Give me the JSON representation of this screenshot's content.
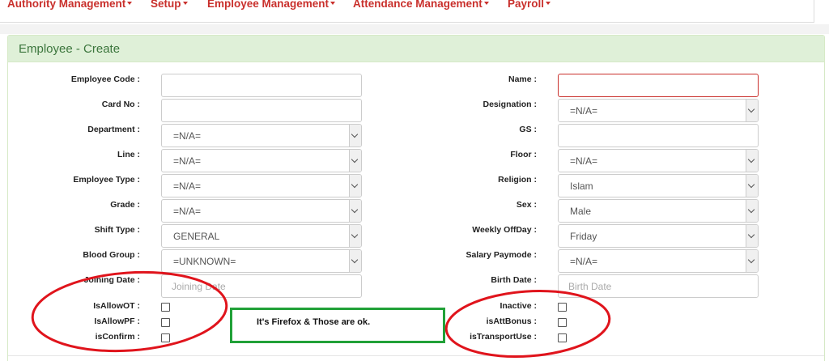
{
  "nav": {
    "items": [
      {
        "label": "Authority Management"
      },
      {
        "label": "Setup"
      },
      {
        "label": "Employee Management"
      },
      {
        "label": "Attendance Management"
      },
      {
        "label": "Payroll"
      }
    ]
  },
  "panel": {
    "title": "Employee - Create"
  },
  "form": {
    "employee_code": {
      "label": "Employee Code :",
      "value": ""
    },
    "card_no": {
      "label": "Card No :",
      "value": ""
    },
    "department": {
      "label": "Department :",
      "value": "=N/A="
    },
    "line": {
      "label": "Line :",
      "value": "=N/A="
    },
    "employee_type": {
      "label": "Employee Type :",
      "value": "=N/A="
    },
    "grade": {
      "label": "Grade :",
      "value": "=N/A="
    },
    "shift_type": {
      "label": "Shift Type :",
      "value": "GENERAL"
    },
    "blood_group": {
      "label": "Blood Group :",
      "value": "=UNKNOWN="
    },
    "joining_date": {
      "label": "Joining Date :",
      "placeholder": "Joining Date"
    },
    "name": {
      "label": "Name :",
      "value": ""
    },
    "designation": {
      "label": "Designation :",
      "value": "=N/A="
    },
    "gs": {
      "label": "GS :",
      "value": ""
    },
    "floor": {
      "label": "Floor :",
      "value": "=N/A="
    },
    "religion": {
      "label": "Religion :",
      "value": "Islam"
    },
    "sex": {
      "label": "Sex :",
      "value": "Male"
    },
    "weekly_offday": {
      "label": "Weekly OffDay :",
      "value": "Friday"
    },
    "salary_paymode": {
      "label": "Salary Paymode :",
      "value": "=N/A="
    },
    "birth_date": {
      "label": "Birth Date :",
      "placeholder": "Birth Date"
    },
    "checkboxes_left": [
      {
        "label": "IsAllowOT :",
        "checked": false
      },
      {
        "label": "IsAllowPF :",
        "checked": false
      },
      {
        "label": "isConfirm :",
        "checked": false
      }
    ],
    "checkboxes_right": [
      {
        "label": "Inactive :",
        "checked": false
      },
      {
        "label": "isAttBonus :",
        "checked": false
      },
      {
        "label": "isTransportUse :",
        "checked": false
      }
    ]
  },
  "annotation": {
    "note": "It's Firefox & Those are ok.",
    "box_color": "#21a138",
    "circle_color": "#e0141c"
  }
}
